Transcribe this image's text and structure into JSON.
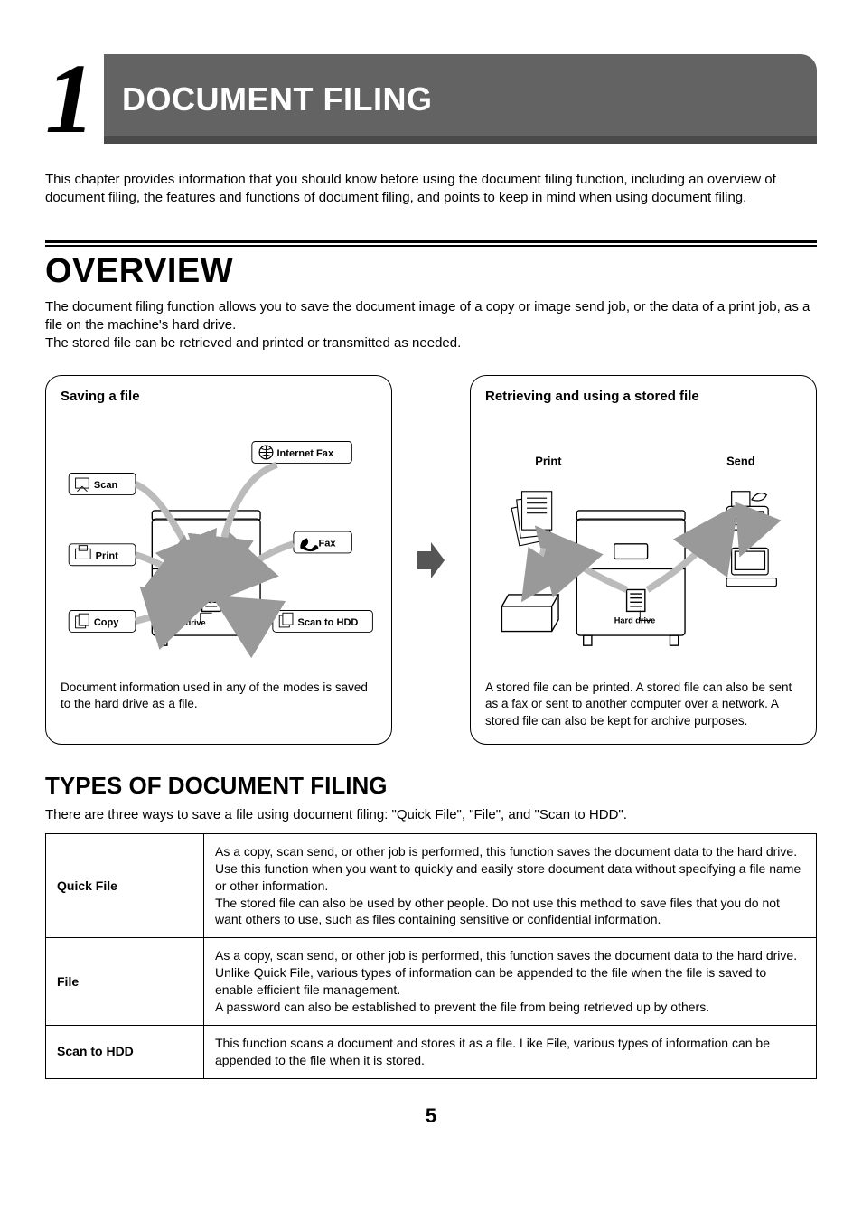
{
  "chapter": {
    "number": "1",
    "title": "DOCUMENT FILING"
  },
  "intro": "This chapter provides information that you should know before using the document filing function, including an overview of document filing, the features and functions of document filing, and points to keep in mind when using document filing.",
  "overview": {
    "title": "OVERVIEW",
    "text": "The document filing function allows you to save the document image of a copy or image send job, or the data of a print job, as a file on the machine's hard drive.\nThe stored file can be retrieved and printed or transmitted as needed."
  },
  "diagrams": {
    "saving": {
      "title": "Saving a file",
      "labels": {
        "internet_fax": "Internet Fax",
        "scan": "Scan",
        "print": "Print",
        "fax": "Fax",
        "copy": "Copy",
        "scan_to_hdd": "Scan to HDD",
        "hard_drive": "Hard drive"
      },
      "caption": "Document information used in any of the modes is saved to the hard drive as a file."
    },
    "retrieving": {
      "title": "Retrieving and using a stored file",
      "labels": {
        "print": "Print",
        "send": "Send",
        "hard_drive": "Hard drive"
      },
      "caption": "A stored file can be printed. A stored file can also be sent as a fax or sent to another computer over a network. A stored file can also be kept for archive purposes."
    }
  },
  "types": {
    "title": "TYPES OF DOCUMENT FILING",
    "intro": "There are three ways to save a file using document filing: \"Quick File\", \"File\", and \"Scan to HDD\".",
    "rows": [
      {
        "label": "Quick File",
        "desc": "As a copy, scan send, or other job is performed, this function saves the document data to the hard drive. Use this function when you want to quickly and easily store document data without specifying a file name or other information.\nThe stored file can also be used by other people. Do not use this method to save files that you do not want others to use, such as files containing sensitive or confidential information."
      },
      {
        "label": "File",
        "desc": "As a copy, scan send, or other job is performed, this function saves the document data to the hard drive. Unlike Quick File, various types of information can be appended to the file when the file is saved to enable efficient file management.\nA password can also be established to prevent the file from being retrieved up by others."
      },
      {
        "label": "Scan to HDD",
        "desc": "This function scans a document and stores it as a file. Like File, various types of information can be appended to the file when it is stored."
      }
    ]
  },
  "page_number": "5"
}
